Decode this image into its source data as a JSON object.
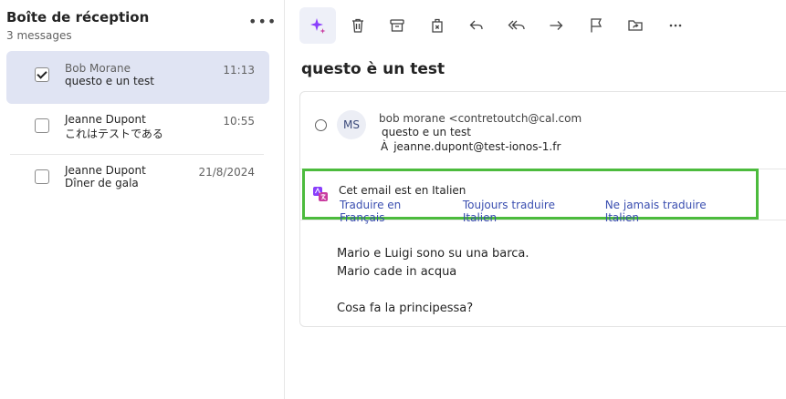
{
  "inbox": {
    "title": "Boîte de réception",
    "count": "3 messages",
    "more": "•••"
  },
  "messages": [
    {
      "sender": "Bob Morane",
      "subject": "questo e un test",
      "time": "11:13",
      "selected": true
    },
    {
      "sender": "Jeanne Dupont",
      "subject": "これはテストである",
      "time": "10:55",
      "selected": false
    },
    {
      "sender": "Jeanne Dupont",
      "subject": "Dîner de gala",
      "time": "21/8/2024",
      "selected": false
    }
  ],
  "toolbar": {
    "icons": [
      "sparkle-icon",
      "trash-icon",
      "archive-icon",
      "delete-all-icon",
      "reply-icon",
      "reply-all-icon",
      "forward-icon",
      "flag-icon",
      "move-icon",
      "more-icon"
    ],
    "accent": "#8a3ffc"
  },
  "mail": {
    "title": "questo è un test",
    "avatar": "MS",
    "from": "bob morane <contretoutch@cal.com",
    "subject": "questo e un test",
    "to_prefix": "À",
    "to": "jeanne.dupont@test-ionos-1.fr",
    "translation": {
      "detected": "Cet email est en Italien",
      "translate": "Traduire en Français",
      "always": "Toujours traduire Italien",
      "never": "Ne jamais traduire Italien",
      "highlight_color": "#4cbb3d"
    },
    "body": {
      "line1": "Mario e Luigi sono su una barca.",
      "line2": "Mario cade in acqua",
      "line3": "Cosa fa la principessa?"
    }
  }
}
